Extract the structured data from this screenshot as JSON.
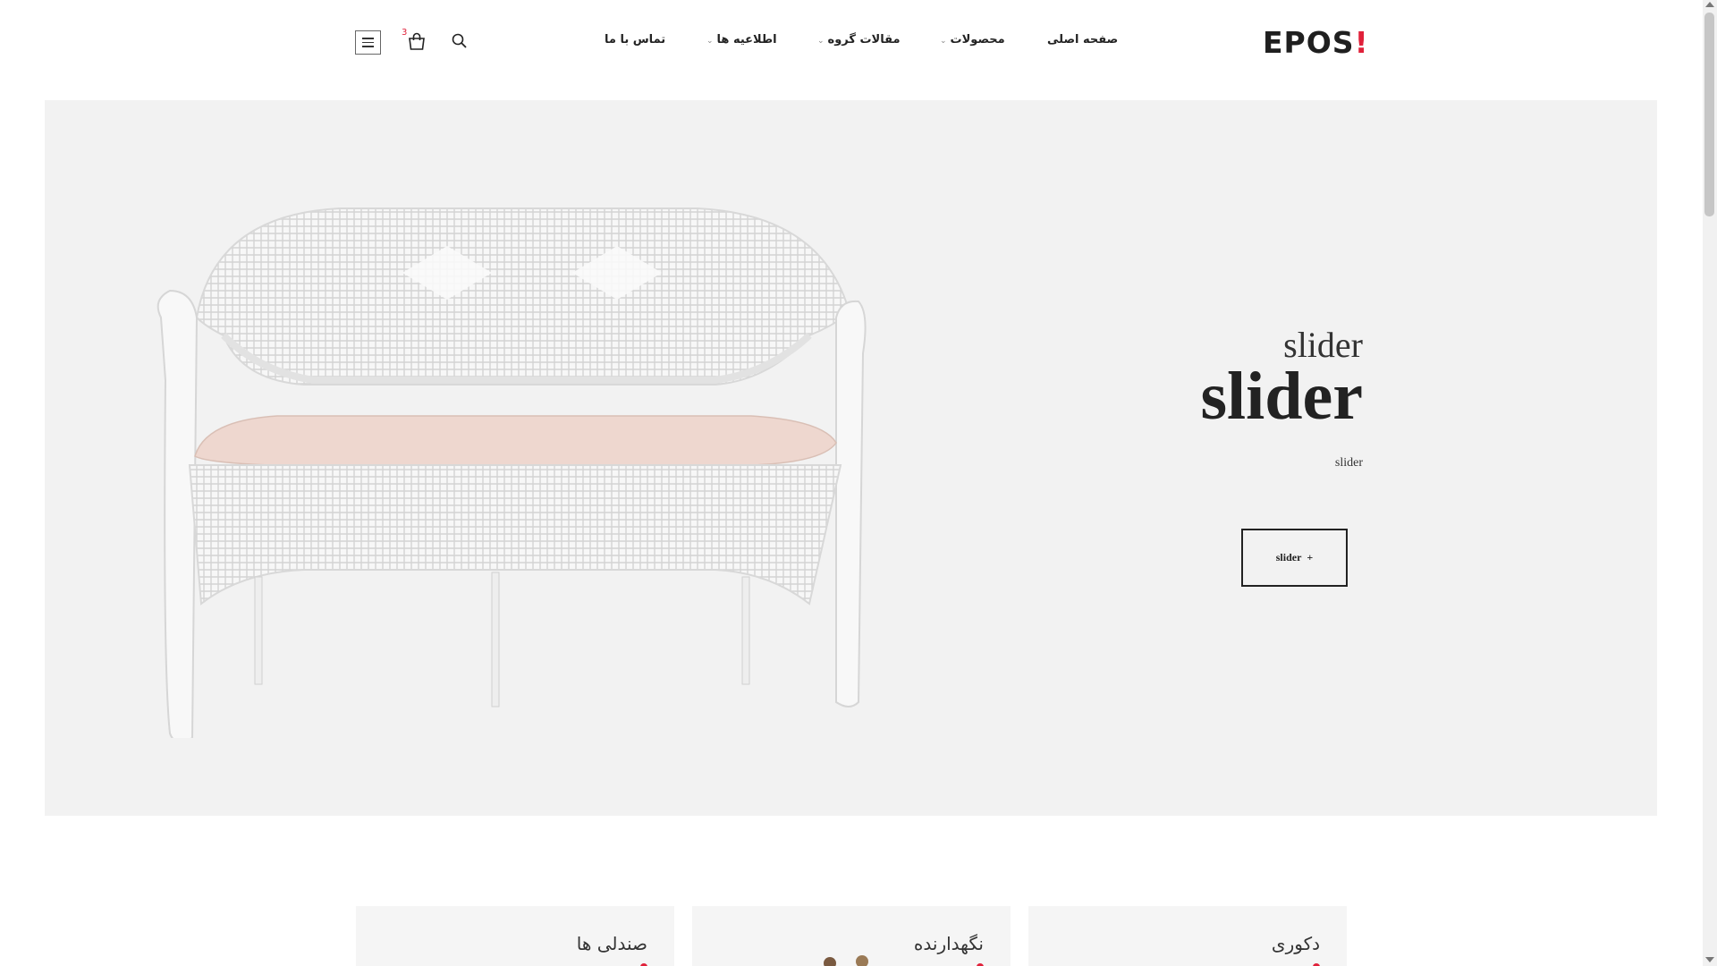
{
  "header": {
    "logo": "EPOS",
    "logo_accent": "!",
    "nav": [
      {
        "label": "صفحه اصلی",
        "has_dropdown": false
      },
      {
        "label": "محصولات",
        "has_dropdown": true
      },
      {
        "label": "مقالات گروه",
        "has_dropdown": true
      },
      {
        "label": "اطلاعیه ها",
        "has_dropdown": true
      },
      {
        "label": "تماس با ما",
        "has_dropdown": false
      }
    ],
    "cart_count": "3",
    "icons": [
      "search-icon",
      "cart-icon",
      "menu-icon"
    ]
  },
  "hero": {
    "subtitle": "slider",
    "title": "slider",
    "description": "slider",
    "button_label": "slider",
    "button_icon": "+"
  },
  "categories": [
    {
      "label": "دکوری"
    },
    {
      "label": "نگهدارنده"
    },
    {
      "label": "صندلی ها"
    }
  ],
  "colors": {
    "accent": "#e0213a",
    "hero_bg": "#f2f2f2",
    "text": "#222222"
  }
}
